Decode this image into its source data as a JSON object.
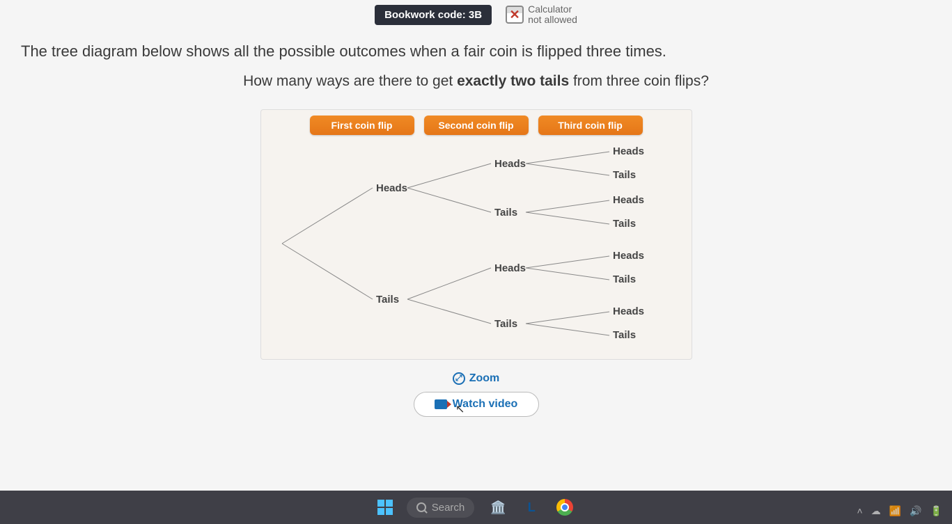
{
  "header": {
    "bookwork_label": "Bookwork code: 3B",
    "calculator_title": "Calculator",
    "calculator_status": "not allowed"
  },
  "question": {
    "line1": "The tree diagram below shows all the possible outcomes when a fair coin is flipped three times.",
    "line2_pre": "How many ways are there to get ",
    "line2_bold": "exactly two tails",
    "line2_post": " from three coin flips?"
  },
  "diagram": {
    "columns": [
      "First coin flip",
      "Second coin flip",
      "Third coin flip"
    ],
    "level1": [
      "Heads",
      "Tails"
    ],
    "level2": [
      "Heads",
      "Tails",
      "Heads",
      "Tails"
    ],
    "level3": [
      "Heads",
      "Tails",
      "Heads",
      "Tails",
      "Heads",
      "Tails",
      "Heads",
      "Tails"
    ]
  },
  "controls": {
    "zoom": "Zoom",
    "watch": "Watch video"
  },
  "taskbar": {
    "search_placeholder": "Search"
  },
  "chart_data": {
    "type": "tree",
    "levels": [
      "First coin flip",
      "Second coin flip",
      "Third coin flip"
    ],
    "root_children": [
      {
        "label": "Heads",
        "children": [
          {
            "label": "Heads",
            "children": [
              {
                "label": "Heads"
              },
              {
                "label": "Tails"
              }
            ]
          },
          {
            "label": "Tails",
            "children": [
              {
                "label": "Heads"
              },
              {
                "label": "Tails"
              }
            ]
          }
        ]
      },
      {
        "label": "Tails",
        "children": [
          {
            "label": "Heads",
            "children": [
              {
                "label": "Heads"
              },
              {
                "label": "Tails"
              }
            ]
          },
          {
            "label": "Tails",
            "children": [
              {
                "label": "Heads"
              },
              {
                "label": "Tails"
              }
            ]
          }
        ]
      }
    ]
  }
}
